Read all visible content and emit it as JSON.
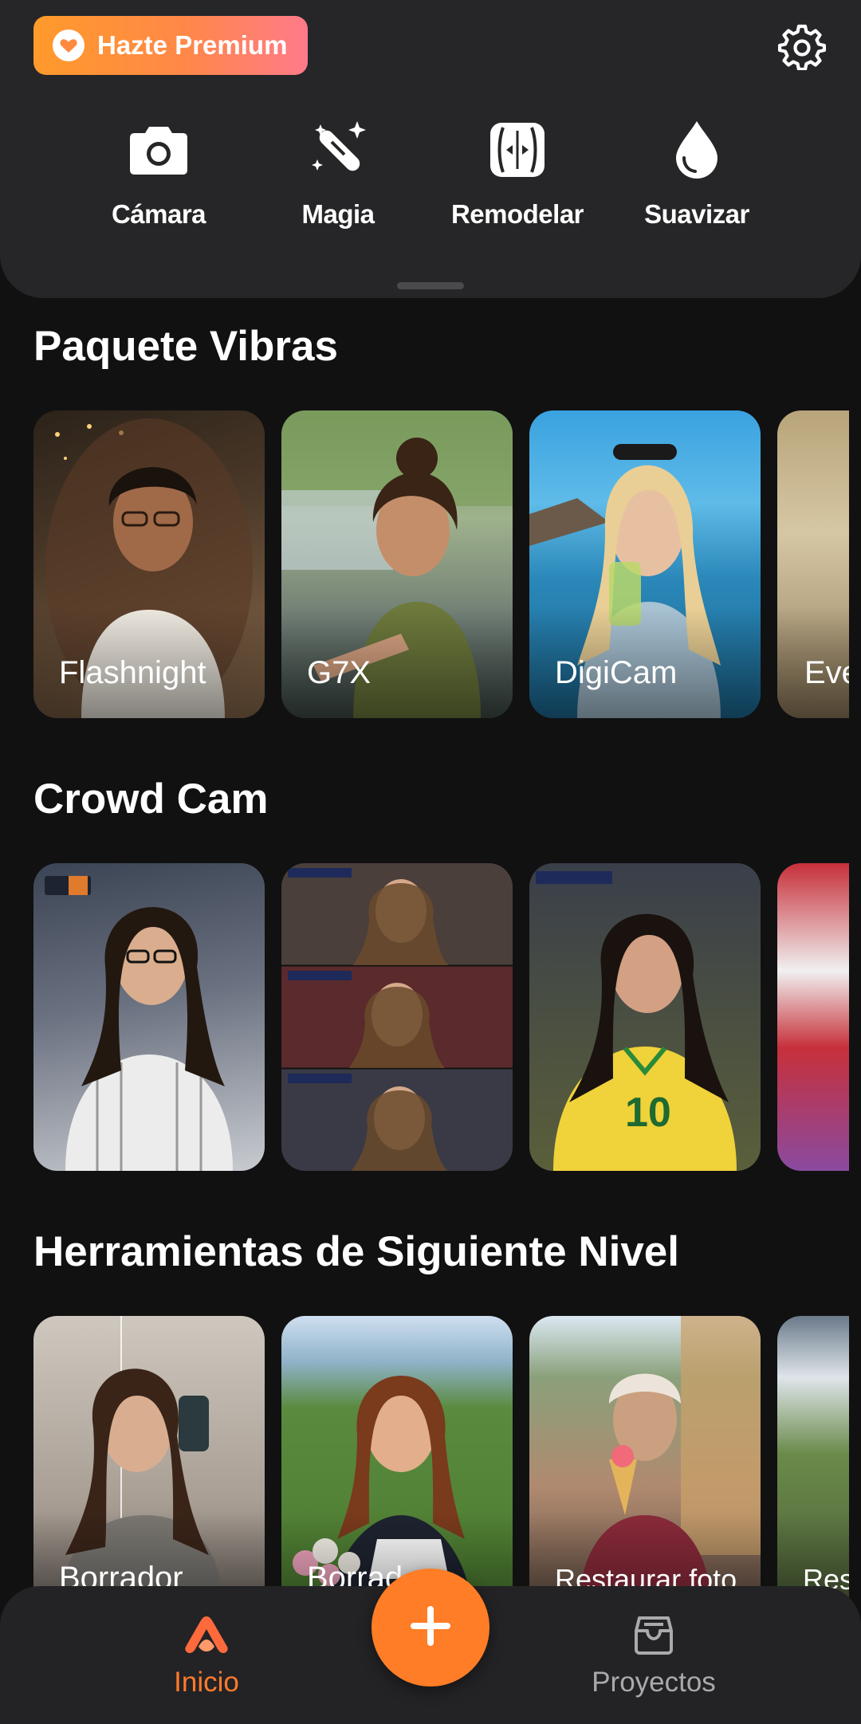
{
  "header": {
    "premium_label": "Hazte Premium",
    "settings_icon": "gear-icon"
  },
  "tools": [
    {
      "label": "Cámara",
      "icon": "camera-icon"
    },
    {
      "label": "Magia",
      "icon": "magic-wand-icon"
    },
    {
      "label": "Remodelar",
      "icon": "reshape-icon"
    },
    {
      "label": "Suavizar",
      "icon": "drop-icon"
    }
  ],
  "sections": [
    {
      "title": "Paquete Vibras",
      "cards": [
        {
          "label": "Flashnight"
        },
        {
          "label": "G7X"
        },
        {
          "label": "DigiCam"
        },
        {
          "label": "Even"
        }
      ]
    },
    {
      "title": "Crowd Cam",
      "cards": [
        {
          "label": ""
        },
        {
          "label": ""
        },
        {
          "label": ""
        },
        {
          "label": ""
        }
      ]
    },
    {
      "title": "Herramientas de Siguiente Nivel",
      "cards": [
        {
          "label": "Borrador"
        },
        {
          "label": "Borrad"
        },
        {
          "label": "Restaurar foto"
        },
        {
          "label": "Rest"
        }
      ]
    }
  ],
  "bottom_nav": {
    "home_label": "Inicio",
    "projects_label": "Proyectos",
    "add_icon": "plus-icon"
  },
  "colors": {
    "accent": "#ff7d26",
    "background": "#111112",
    "panel": "#262628"
  }
}
